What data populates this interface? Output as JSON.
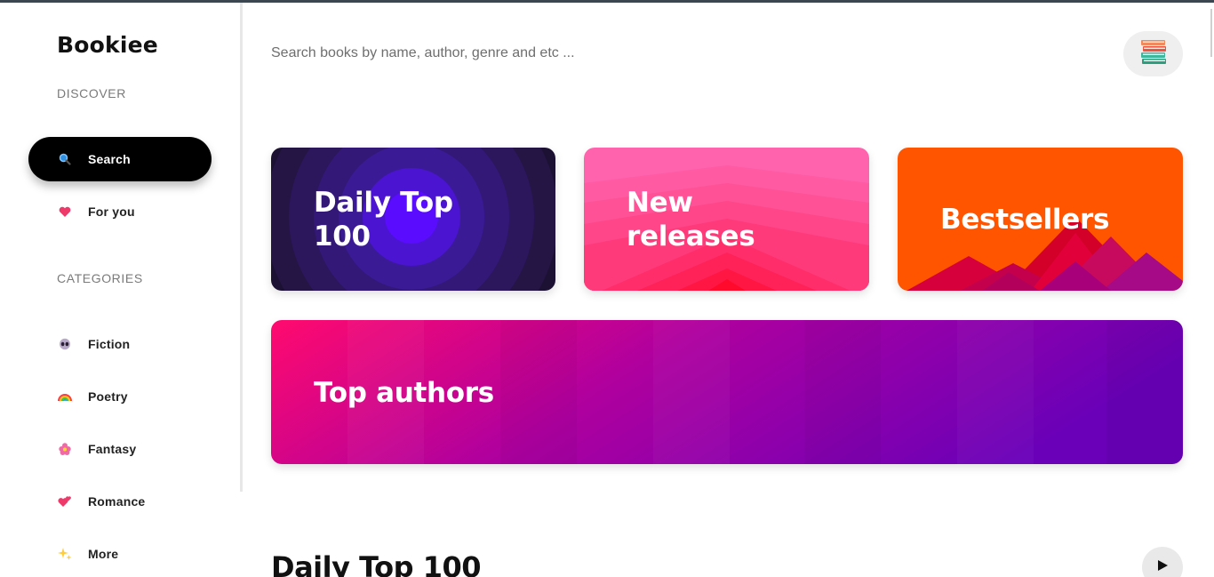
{
  "app": {
    "name": "Bookiee"
  },
  "sidebar": {
    "discover_label": "DISCOVER",
    "discover_items": [
      {
        "label": "Search",
        "icon": "magnifier-icon",
        "active": true
      },
      {
        "label": "For you",
        "icon": "heart-icon",
        "active": false
      }
    ],
    "categories_label": "CATEGORIES",
    "category_items": [
      {
        "label": "Fiction",
        "icon": "alien-icon"
      },
      {
        "label": "Poetry",
        "icon": "rainbow-icon"
      },
      {
        "label": "Fantasy",
        "icon": "flower-icon"
      },
      {
        "label": "Romance",
        "icon": "two-hearts-icon"
      },
      {
        "label": "More",
        "icon": "sparkles-icon"
      }
    ]
  },
  "search": {
    "placeholder": "Search books by name, author, genre and etc ...",
    "value": ""
  },
  "header": {
    "avatar_icon": "books-stack-icon"
  },
  "cards": [
    {
      "title": "Daily Top",
      "title2": "100",
      "colors": [
        "#1f1240",
        "#3a1a8a",
        "#5a10ff"
      ]
    },
    {
      "title": "New",
      "title2": "releases",
      "colors": [
        "#ff5ca8",
        "#ff1f4b"
      ]
    },
    {
      "title": "Bestsellers",
      "colors": [
        "#ff5a00",
        "#c8003a"
      ]
    },
    {
      "title": "Top authors",
      "colors": [
        "#ff0a6e",
        "#6a00b8"
      ]
    }
  ],
  "sections": {
    "heading": "Daily Top 100"
  }
}
